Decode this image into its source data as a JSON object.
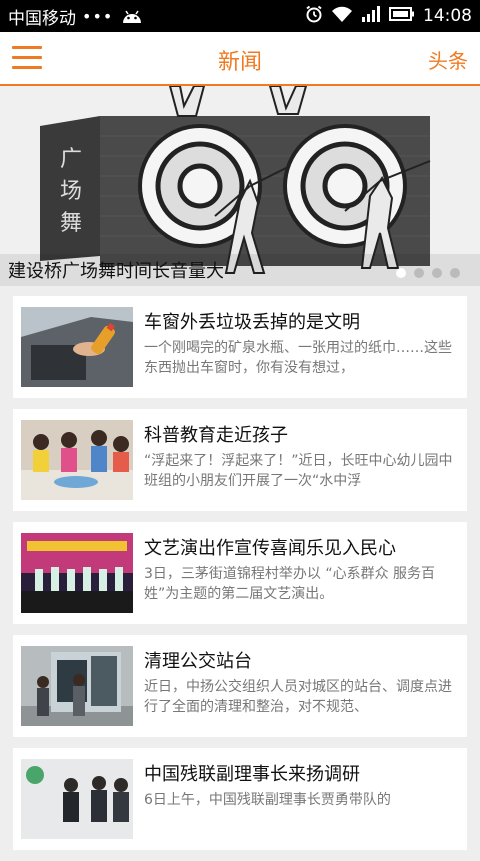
{
  "status_bar": {
    "carrier": "中国移动",
    "dots": "•••",
    "time": "14:08"
  },
  "header": {
    "title": "新闻",
    "right_tab": "头条"
  },
  "banner": {
    "caption": "建设桥广场舞时间长音量大",
    "pages": 4,
    "active_page": 0
  },
  "news": [
    {
      "headline": "车窗外丢垃圾丢掉的是文明",
      "summary": "一个刚喝完的矿泉水瓶、一张用过的纸巾……这些东西抛出车窗时，你有没有想过，",
      "thumb": "car-window-bottle"
    },
    {
      "headline": "科普教育走近孩子",
      "summary": "“浮起来了！浮起来了！”近日，长旺中心幼儿园中班组的小朋友们开展了一次“水中浮",
      "thumb": "kids-classroom"
    },
    {
      "headline": "文艺演出作宣传喜闻乐见入民心",
      "summary": "3日，三茅街道锦程村举办以 “心系群众 服务百姓”为主题的第二届文艺演出。",
      "thumb": "stage-performance"
    },
    {
      "headline": "清理公交站台",
      "summary": "近日，中扬公交组织人员对城区的站台、调度点进行了全面的清理和整治，对不规范、",
      "thumb": "bus-stop"
    },
    {
      "headline": "中国残联副理事长来扬调研",
      "summary": "6日上午，中国残联副理事长贾勇带队的",
      "thumb": "meeting-visit"
    }
  ]
}
